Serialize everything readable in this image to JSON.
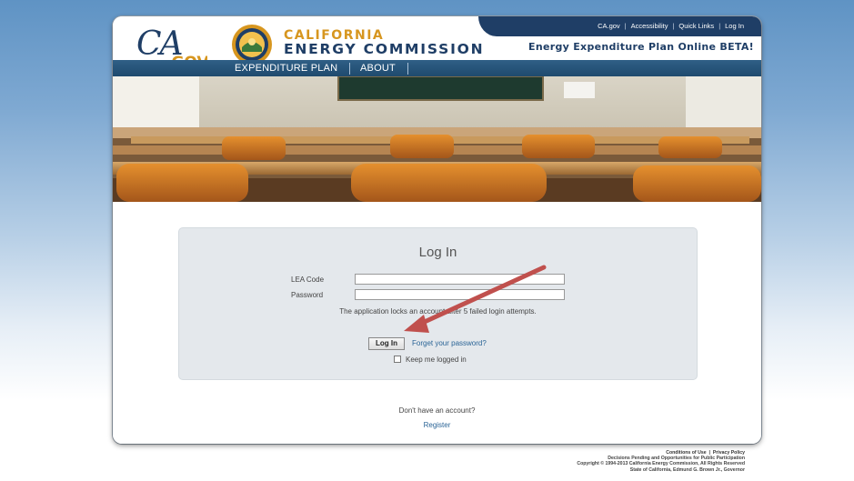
{
  "header": {
    "toplinks": [
      "CA.gov",
      "Accessibility",
      "Quick Links",
      "Log In"
    ],
    "logo_text": "CA.GOV",
    "agency_line1": "CALIFORNIA",
    "agency_line2": "ENERGY COMMISSION",
    "app_title": "Energy Expenditure Plan Online BETA!",
    "nav": [
      "EXPENDITURE PLAN",
      "ABOUT"
    ]
  },
  "login": {
    "title": "Log In",
    "lea_label": "LEA Code",
    "lea_value": "",
    "password_label": "Password",
    "password_value": "",
    "lock_note": "The application locks an account after 5 failed login attempts.",
    "button": "Log In",
    "forgot": "Forget your password?",
    "keep_logged_in": "Keep me logged in",
    "keep_checked": false
  },
  "signup": {
    "prompt": "Don't have an account?",
    "register": "Register"
  },
  "footer": {
    "links": [
      "Conditions of Use",
      "Privacy Policy"
    ],
    "line2": "Decisions Pending and Opportunities for Public Participation",
    "line3": "Copyright © 1994-2013 California Energy Commission, All Rights Reserved",
    "line4": "State of California, Edmund G. Brown Jr., Governor"
  },
  "colors": {
    "brand_navy": "#1f3e66",
    "brand_gold": "#d7961f",
    "link": "#2a6496",
    "annotation_arrow": "#c0504d"
  }
}
